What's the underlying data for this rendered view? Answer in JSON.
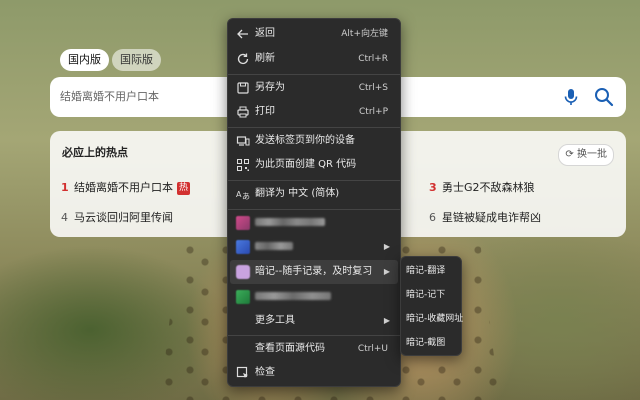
{
  "region_tabs": {
    "domestic": "国内版",
    "international": "国际版"
  },
  "search": {
    "query": "结婚离婚不用户口本"
  },
  "hot": {
    "title": "必应上的热点",
    "refresh_label": "换一批",
    "items": [
      {
        "rank": "1",
        "text": "结婚离婚不用户口本",
        "badge": "热"
      },
      {
        "rank": "3",
        "text": "勇士G2不敌森林狼"
      },
      {
        "rank": "4",
        "text": "马云谈回归阿里传闻"
      },
      {
        "rank": "6",
        "text": "星链被疑成电诈帮凶"
      }
    ]
  },
  "context_menu": {
    "back": {
      "label": "返回",
      "shortcut": "Alt+向左键"
    },
    "refresh": {
      "label": "刷新",
      "shortcut": "Ctrl+R"
    },
    "save_as": {
      "label": "另存为",
      "shortcut": "Ctrl+S"
    },
    "print": {
      "label": "打印",
      "shortcut": "Ctrl+P"
    },
    "send_to_devices": {
      "label": "发送标签页到你的设备"
    },
    "qr_code": {
      "label": "为此页面创建 QR 代码"
    },
    "translate": {
      "label": "翻译为 中文 (简体)"
    },
    "note_extension": {
      "label": "暗记--随手记录，及时复习"
    },
    "more_tools": {
      "label": "更多工具"
    },
    "view_source": {
      "label": "查看页面源代码",
      "shortcut": "Ctrl+U"
    },
    "inspect": {
      "label": "检查"
    }
  },
  "submenu": {
    "items": [
      "暗记-翻译",
      "暗记-记下",
      "暗记-收藏网址",
      "暗记-截图"
    ]
  },
  "colors": {
    "hot_red": "#d2302f",
    "menu_bg": "#2b2b2b",
    "search_icon_blue": "#1a5fb4"
  }
}
